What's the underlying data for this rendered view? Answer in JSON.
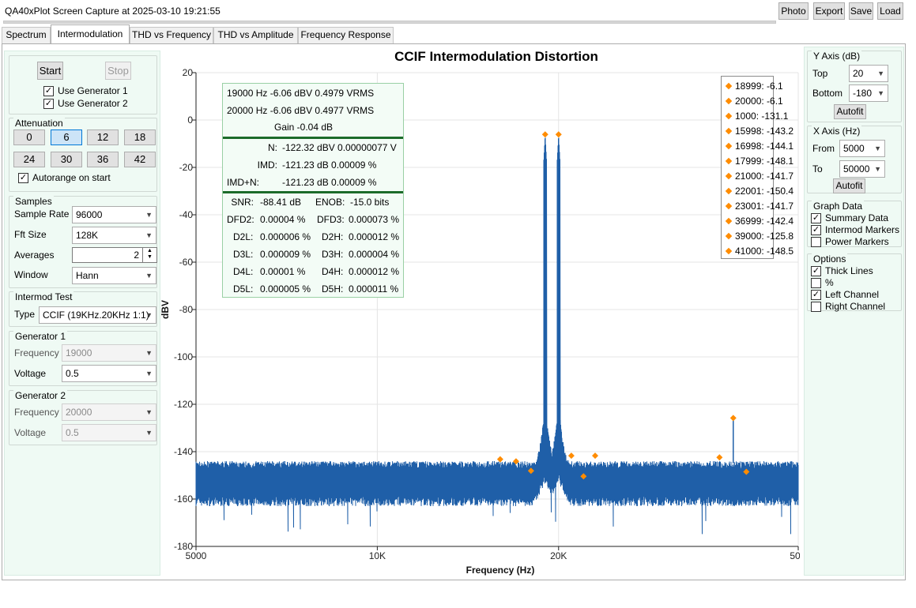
{
  "window": {
    "title": "QA40xPlot Screen Capture at 2025-03-10 19:21:55",
    "buttons": [
      "Photo",
      "Export",
      "Save",
      "Load"
    ]
  },
  "tabs": [
    "Spectrum",
    "Intermodulation",
    "THD vs Frequency",
    "THD vs Amplitude",
    "Frequency Response"
  ],
  "active_tab": "Intermodulation",
  "left": {
    "start_label": "Start",
    "stop_label": "Stop",
    "use_gen1": "Use Generator 1",
    "use_gen2": "Use Generator 2",
    "attenuation_label": "Attenuation",
    "attenuation_values": [
      "0",
      "6",
      "12",
      "18",
      "24",
      "30",
      "36",
      "42"
    ],
    "attenuation_selected": "6",
    "autorange": "Autorange on start",
    "samples_label": "Samples",
    "sample_rate_label": "Sample Rate",
    "sample_rate": "96000",
    "fft_size_label": "Fft Size",
    "fft_size": "128K",
    "averages_label": "Averages",
    "averages": "2",
    "window_label": "Window",
    "window": "Hann",
    "intermod_label": "Intermod Test",
    "type_label": "Type",
    "type": "CCIF (19KHz.20KHz 1:1)",
    "gen1_label": "Generator 1",
    "gen1_freq_label": "Frequency",
    "gen1_freq": "19000",
    "gen1_volt_label": "Voltage",
    "gen1_volt": "0.5",
    "gen2_label": "Generator 2",
    "gen2_freq_label": "Frequency",
    "gen2_freq": "20000",
    "gen2_volt_label": "Voltage",
    "gen2_volt": "0.5"
  },
  "right": {
    "yaxis_label": "Y Axis (dB)",
    "top_label": "Top",
    "top": "20",
    "bottom_label": "Bottom",
    "bottom": "-180",
    "autofit": "Autofit",
    "xaxis_label": "X Axis (Hz)",
    "from_label": "From",
    "from": "5000",
    "to_label": "To",
    "to": "50000",
    "graphdata_label": "Graph Data",
    "summary_data": "Summary Data",
    "intermod_markers": "Intermod Markers",
    "power_markers": "Power Markers",
    "options_label": "Options",
    "thick_lines": "Thick Lines",
    "percent": "%",
    "left_channel": "Left Channel",
    "right_channel": "Right Channel"
  },
  "summary": {
    "l1": "19000 Hz   -6.06 dBV   0.4979 VRMS",
    "l2": "20000 Hz   -6.06 dBV   0.4977 VRMS",
    "l3": "Gain -0.04 dB",
    "n_label": "N:",
    "n_val": "-122.32 dBV   0.00000077 V",
    "imd_label": "IMD:",
    "imd_val": "-121.23 dB      0.00009 %",
    "imdn_label": "IMD+N:",
    "imdn_val": "-121.23 dB      0.00009 %",
    "snr_label": "SNR:",
    "snr_val": "-88.41 dB",
    "enob_label": "ENOB:",
    "enob_val": "-15.0 bits",
    "dfd2_label": "DFD2:",
    "dfd2_val": "0.00004 %",
    "dfd3_label": "DFD3:",
    "dfd3_val": "0.000073 %",
    "d2l_label": "D2L:",
    "d2l_val": "0.000006 %",
    "d2h_label": "D2H:",
    "d2h_val": "0.000012 %",
    "d3l_label": "D3L:",
    "d3l_val": "0.000009 %",
    "d3h_label": "D3H:",
    "d3h_val": "0.000004 %",
    "d4l_label": "D4L:",
    "d4l_val": "0.00001 %",
    "d4h_label": "D4H:",
    "d4h_val": "0.000012 %",
    "d5l_label": "D5L:",
    "d5l_val": "0.000005 %",
    "d5h_label": "D5H:",
    "d5h_val": "0.000011 %"
  },
  "markers_list": [
    "18999: -6.1",
    "20000: -6.1",
    "1000: -131.1",
    "15998: -143.2",
    "16998: -144.1",
    "17999: -148.1",
    "21000: -141.7",
    "22001: -150.4",
    "23001: -141.7",
    "36999: -142.4",
    "39000: -125.8",
    "41000: -148.5"
  ],
  "colors": {
    "trace": "#1f5fa8",
    "marker": "#ff8c00",
    "panel": "#effaf4"
  },
  "chart_data": {
    "type": "line",
    "title": "CCIF  Intermodulation Distortion",
    "xlabel": "Frequency (Hz)",
    "ylabel": "dBV",
    "xscale": "log",
    "xlim": [
      5000,
      50000
    ],
    "ylim": [
      -180,
      20
    ],
    "xticks": [
      5000,
      10000,
      20000,
      50000
    ],
    "xtick_labels": [
      "5000",
      "10K",
      "20K",
      "50K"
    ],
    "yticks": [
      20,
      0,
      -20,
      -40,
      -60,
      -80,
      -100,
      -120,
      -140,
      -160,
      -180
    ],
    "noise_floor": [
      -160,
      -145
    ],
    "peaks": [
      {
        "x": 18999,
        "y": -6.1
      },
      {
        "x": 20000,
        "y": -6.1
      }
    ],
    "markers": [
      {
        "x": 15998,
        "y": -143.2
      },
      {
        "x": 16998,
        "y": -144.1
      },
      {
        "x": 17999,
        "y": -148.1
      },
      {
        "x": 18999,
        "y": -6.1
      },
      {
        "x": 20000,
        "y": -6.1
      },
      {
        "x": 21000,
        "y": -141.7
      },
      {
        "x": 22001,
        "y": -150.4
      },
      {
        "x": 23001,
        "y": -141.7
      },
      {
        "x": 36999,
        "y": -142.4
      },
      {
        "x": 39000,
        "y": -125.8
      },
      {
        "x": 41000,
        "y": -148.5
      }
    ],
    "legend": "top-right",
    "grid": true
  }
}
